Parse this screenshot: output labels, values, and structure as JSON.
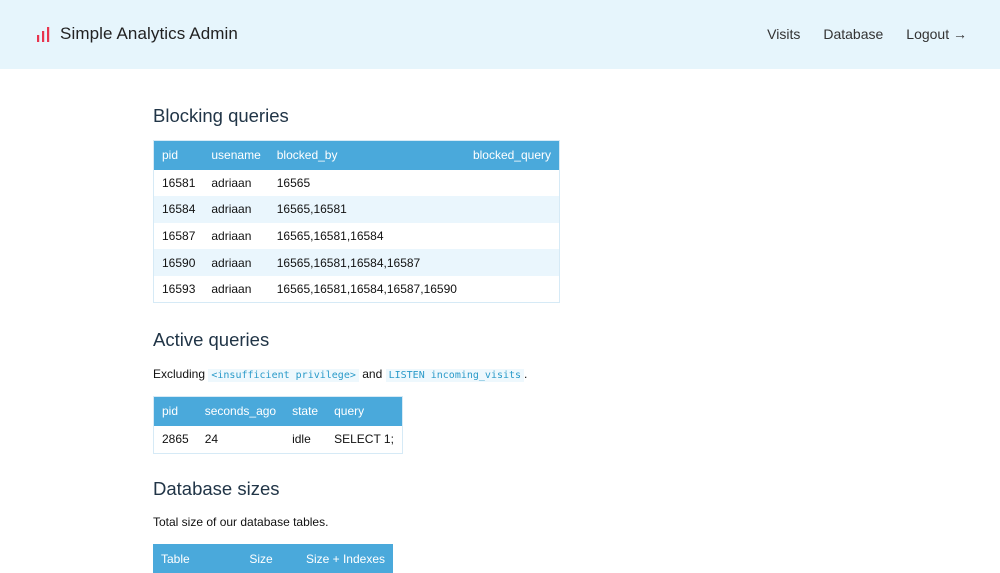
{
  "header": {
    "title": "Simple Analytics Admin",
    "brand_color": "#e8344e",
    "nav": [
      {
        "label": "Visits"
      },
      {
        "label": "Database"
      },
      {
        "label": "Logout →"
      }
    ]
  },
  "blocking": {
    "title": "Blocking queries",
    "columns": [
      "pid",
      "usename",
      "blocked_by",
      "blocked_query"
    ],
    "rows": [
      [
        "16581",
        "adriaan",
        "16565",
        ""
      ],
      [
        "16584",
        "adriaan",
        "16565,16581",
        ""
      ],
      [
        "16587",
        "adriaan",
        "16565,16581,16584",
        ""
      ],
      [
        "16590",
        "adriaan",
        "16565,16581,16584,16587",
        ""
      ],
      [
        "16593",
        "adriaan",
        "16565,16581,16584,16587,16590",
        ""
      ]
    ]
  },
  "active": {
    "title": "Active queries",
    "intro_prefix": "Excluding",
    "code1": "<insufficient privilege>",
    "intro_and": "and",
    "code2": "LISTEN incoming_visits",
    "intro_suffix": ".",
    "columns": [
      "pid",
      "seconds_ago",
      "state",
      "query"
    ],
    "rows": [
      [
        "2865",
        "24",
        "idle",
        "SELECT 1;"
      ]
    ]
  },
  "sizes": {
    "title": "Database sizes",
    "intro": "Total size of our database tables.",
    "columns": [
      "Table",
      "Size",
      "Size + Indexes"
    ]
  },
  "colors": {
    "header_bg": "#e6f5fc",
    "table_header": "#4aa9db",
    "row_stripe": "#eaf6fd",
    "code_text": "#2a9ac9"
  }
}
